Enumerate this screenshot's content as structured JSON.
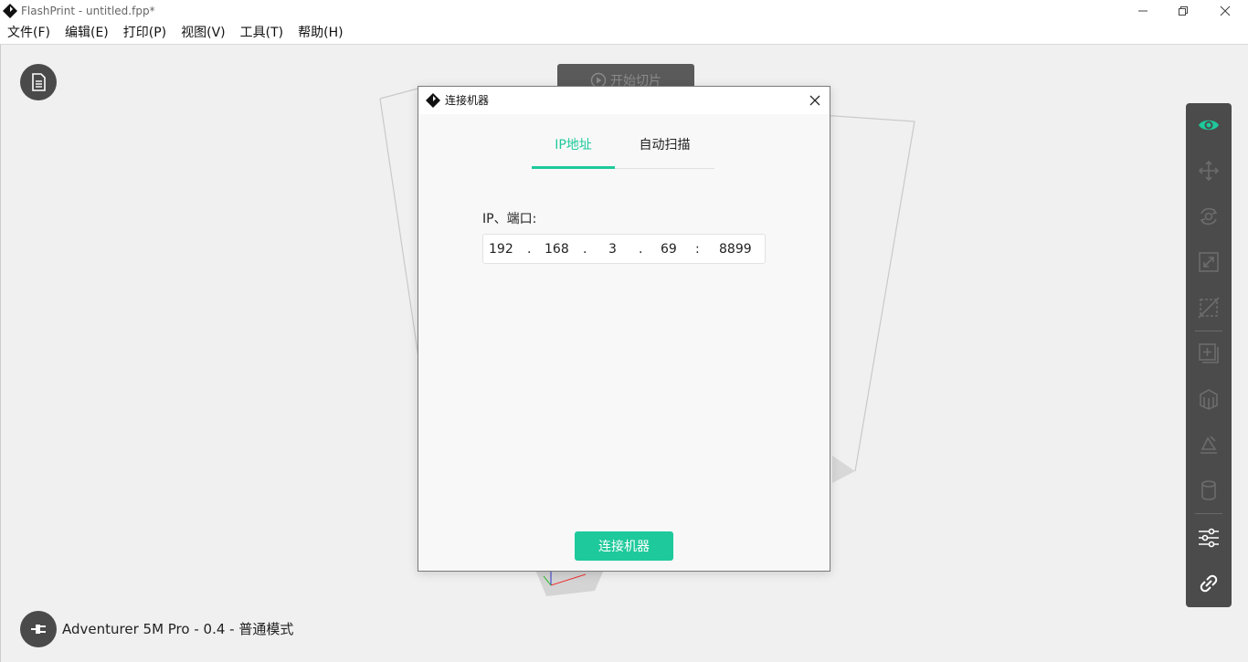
{
  "app": {
    "title": "FlashPrint - untitled.fpp*"
  },
  "menu": [
    "文件(F)",
    "编辑(E)",
    "打印(P)",
    "视图(V)",
    "工具(T)",
    "帮助(H)"
  ],
  "viewport": {
    "slice_button": "开始切片",
    "machine_status": "Adventurer 5M Pro - 0.4 - 普通模式"
  },
  "toolbar": {
    "items": [
      "view-icon",
      "move-icon",
      "rotate-icon",
      "scale-icon",
      "cut-icon",
      "add-icon",
      "support-icon",
      "drop-icon",
      "cylinder-icon",
      "settings-icon",
      "link-icon"
    ],
    "active": "view-icon"
  },
  "dialog": {
    "title": "连接机器",
    "tabs": [
      "IP地址",
      "自动扫描"
    ],
    "active_tab": "IP地址",
    "ip_label": "IP、端口:",
    "ip": {
      "octet1": "192",
      "octet2": "168",
      "octet3": "3",
      "octet4": "69",
      "port": "8899",
      "dot": ".",
      "colon": ":"
    },
    "connect_button": "连接机器"
  },
  "colors": {
    "accent": "#1ec99b",
    "toolbar_bg": "#4b4b4b",
    "viewport_bg": "#f0f0f0"
  }
}
